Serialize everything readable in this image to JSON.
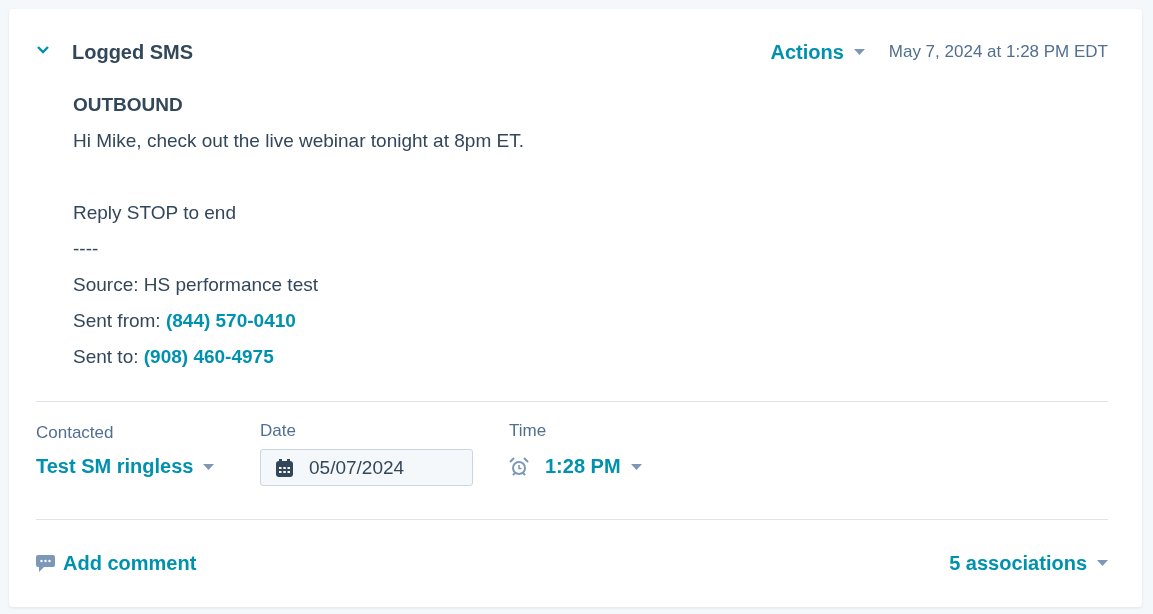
{
  "activity": {
    "title": "Logged SMS",
    "expanded": true,
    "actions_label": "Actions",
    "timestamp": "May 7, 2024 at 1:28 PM EDT"
  },
  "message": {
    "direction": "OUTBOUND",
    "paragraphs": [
      [
        "Hi Mike, check out the live webinar tonight at 8pm ET."
      ],
      [
        "Reply STOP to end",
        "----",
        "Source: HS performance test"
      ]
    ],
    "details": [
      {
        "label": "Sent from:",
        "phone": "(844) 570-0410"
      },
      {
        "label": "Sent to:",
        "phone": "(908) 460-4975"
      }
    ]
  },
  "fields": {
    "contacted": {
      "label": "Contacted",
      "value": "Test SM ringless"
    },
    "date": {
      "label": "Date",
      "value": "05/07/2024"
    },
    "time": {
      "label": "Time",
      "value": "1:28 PM"
    }
  },
  "footer": {
    "comment_label": "Add comment",
    "associations_label": "5 associations"
  }
}
